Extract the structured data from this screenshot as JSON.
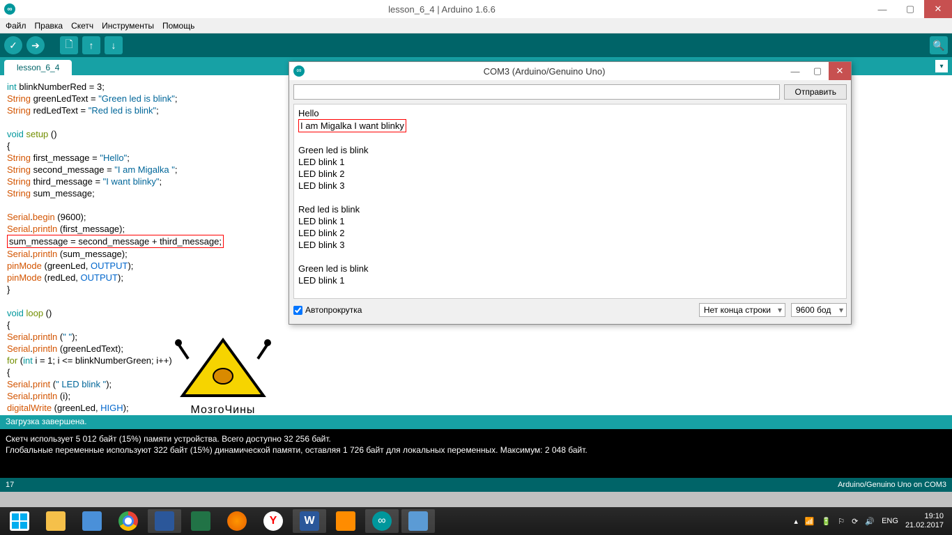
{
  "window": {
    "title": "lesson_6_4 | Arduino 1.6.6"
  },
  "menu": [
    "Файл",
    "Правка",
    "Скетч",
    "Инструменты",
    "Помощь"
  ],
  "tab": "lesson_6_4",
  "code": {
    "l1a": "int",
    "l1b": " blinkNumberRed = 3;",
    "l2a": "String",
    "l2b": " greenLedText = ",
    "l2c": "\"Green led is blink\"",
    "l2d": ";",
    "l3a": "String",
    "l3b": " redLedText = ",
    "l3c": "\"Red led is blink\"",
    "l3d": ";",
    "l5a": "void",
    "l5b": "setup",
    "l5c": " ()",
    "l6": "{",
    "l7a": "String",
    "l7b": " first_message = ",
    "l7c": "\"Hello\"",
    "l7d": ";",
    "l8a": "String",
    "l8b": " second_message = ",
    "l8c": "\"I am Migalka \"",
    "l8d": ";",
    "l9a": "String",
    "l9b": " third_message = ",
    "l9c": "\"I want blinky\"",
    "l9d": ";",
    "l10a": "String",
    "l10b": " sum_message;",
    "l12a": "Serial",
    "l12b": ".",
    "l12c": "begin",
    "l12d": " (9600);",
    "l13a": "Serial",
    "l13b": ".",
    "l13c": "println",
    "l13d": " (first_message);",
    "l14": "sum_message = second_message + third_message;",
    "l15a": "Serial",
    "l15b": ".",
    "l15c": "println",
    "l15d": " (sum_message);",
    "l16a": "pinMode",
    "l16b": " (greenLed, ",
    "l16c": "OUTPUT",
    "l16d": ");",
    "l17a": "pinMode",
    "l17b": " (redLed, ",
    "l17c": "OUTPUT",
    "l17d": ");",
    "l18": "}",
    "l20a": "void",
    "l20b": "loop",
    "l20c": " ()",
    "l21": "{",
    "l22a": "Serial",
    "l22b": ".",
    "l22c": "println",
    "l22d": " (",
    "l22e": "\" \"",
    "l22f": ");",
    "l23a": "Serial",
    "l23b": ".",
    "l23c": "println",
    "l23d": " (greenLedText);",
    "l24a": "for",
    "l24b": " (",
    "l24c": "int",
    "l24d": " i = 1; i <= blinkNumberGreen; i++)",
    "l25": "  {",
    "l26a": "  Serial",
    "l26b": ".",
    "l26c": "print",
    "l26d": " (",
    "l26e": "\"   LED blink \"",
    "l26f": ");",
    "l27a": "  Serial",
    "l27b": ".",
    "l27c": "println",
    "l27d": " (i);",
    "l28a": "  digitalWrite",
    "l28b": " (greenLed, ",
    "l28c": "HIGH",
    "l28d": ");"
  },
  "watermark": "МозгоЧины",
  "status": "Загрузка завершена.",
  "console": {
    "l1": "Скетч использует 5 012 байт (15%) памяти устройства. Всего доступно 32 256 байт.",
    "l2": "Глобальные переменные используют 322 байт (15%) динамической памяти, оставляя 1 726 байт для локальных переменных. Максимум: 2 048 байт."
  },
  "footer": {
    "left": "17",
    "right": "Arduino/Genuino Uno on COM3"
  },
  "serial": {
    "title": "COM3 (Arduino/Genuino Uno)",
    "send": "Отправить",
    "out": {
      "l1": "Hello",
      "l2": "I am Migalka I want blinky",
      "l4": "Green led is blink",
      "l5": "   LED blink 1",
      "l6": "   LED blink 2",
      "l7": "   LED blink 3",
      "l9": "Red led is blink",
      "l10": "   LED blink 1",
      "l11": "   LED blink 2",
      "l12": "   LED blink 3",
      "l14": "Green led is blink",
      "l15": "   LED blink 1"
    },
    "autoscroll": "Автопрокрутка",
    "lineending": "Нет конца строки",
    "baud": "9600 бод"
  },
  "tray": {
    "lang": "ENG",
    "time": "19:10",
    "date": "21.02.2017"
  }
}
